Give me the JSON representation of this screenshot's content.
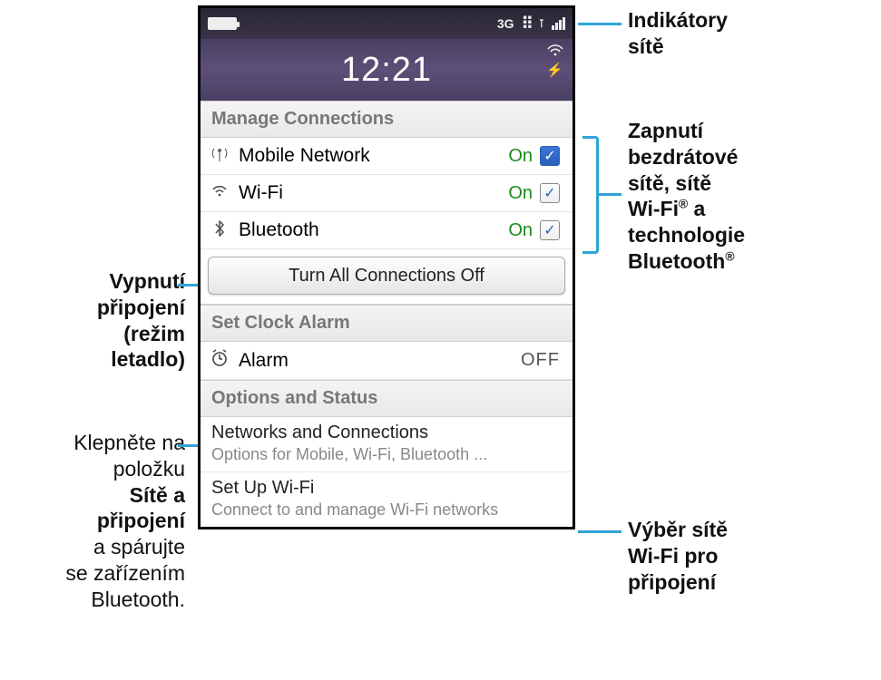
{
  "statusbar": {
    "network_label": "3G"
  },
  "clock": {
    "time": "12:21"
  },
  "sections": {
    "manage": "Manage Connections",
    "alarm": "Set Clock Alarm",
    "options": "Options and Status"
  },
  "connections": {
    "mobile": {
      "label": "Mobile Network",
      "state": "On"
    },
    "wifi": {
      "label": "Wi-Fi",
      "state": "On"
    },
    "bt": {
      "label": "Bluetooth",
      "state": "On"
    }
  },
  "button": {
    "turn_off": "Turn All Connections Off"
  },
  "alarm": {
    "label": "Alarm",
    "state": "OFF"
  },
  "options": {
    "net": {
      "title": "Networks and Connections",
      "sub": "Options for Mobile, Wi-Fi, Bluetooth ..."
    },
    "setupwifi": {
      "title": "Set Up Wi-Fi",
      "sub": "Connect to and manage Wi-Fi networks"
    }
  },
  "callouts": {
    "left_turnoff_1": "Vypnutí",
    "left_turnoff_2": "připojení",
    "left_turnoff_3": "(režim",
    "left_turnoff_4": "letadlo)",
    "left_net_1": "Klepněte na",
    "left_net_2": "položku",
    "left_net_3": "Sítě a",
    "left_net_4": "připojení",
    "left_net_5": "a spárujte",
    "left_net_6": "se zařízením",
    "left_net_7": "Bluetooth.",
    "right_ind_1": "Indikátory",
    "right_ind_2": "sítě",
    "right_toggle_1": "Zapnutí",
    "right_toggle_2": "bezdrátové",
    "right_toggle_3": "sítě, sítě",
    "right_toggle_4a": "Wi-Fi",
    "right_toggle_4b": " a",
    "right_toggle_5": "technologie",
    "right_toggle_6": "Bluetooth",
    "right_wifi_1": "Výběr sítě",
    "right_wifi_2": "Wi-Fi pro",
    "right_wifi_3": "připojení"
  }
}
